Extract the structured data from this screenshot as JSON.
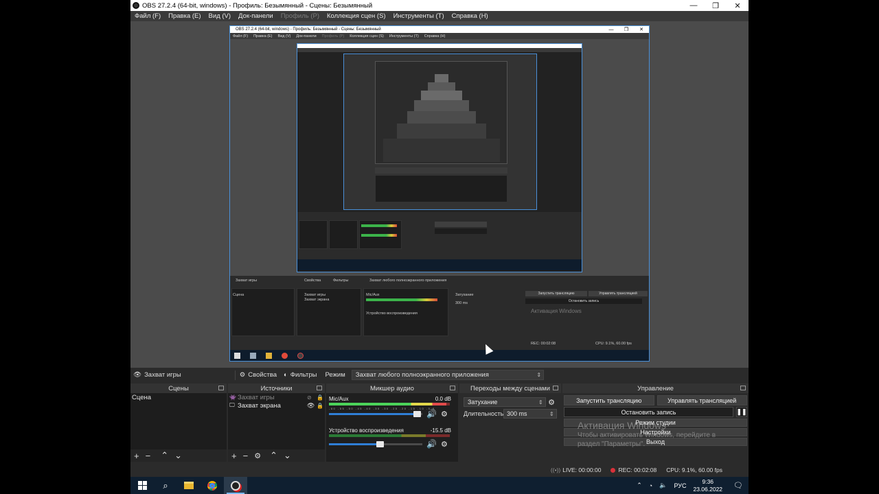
{
  "window": {
    "title": "OBS 27.2.4 (64-bit, windows) - Профиль: Безымянный - Сцены: Безымянный",
    "minimize": "—",
    "restore": "❐",
    "close": "✕"
  },
  "menu": [
    {
      "label": "Файл (F)",
      "disabled": false
    },
    {
      "label": "Правка (E)",
      "disabled": false
    },
    {
      "label": "Вид (V)",
      "disabled": false
    },
    {
      "label": "Док-панели",
      "disabled": false
    },
    {
      "label": "Профиль (P)",
      "disabled": true
    },
    {
      "label": "Коллекция сцен (S)",
      "disabled": false
    },
    {
      "label": "Инструменты (T)",
      "disabled": false
    },
    {
      "label": "Справка (H)",
      "disabled": false
    }
  ],
  "source_toolbar": {
    "current_source": "Захват игры",
    "properties": "Свойства",
    "filters": "Фильтры",
    "mode_label": "Режим",
    "mode_value": "Захват любого полноэкранного приложения"
  },
  "docks": {
    "scenes": {
      "title": "Сцены",
      "items": [
        "Сцена"
      ]
    },
    "sources": {
      "title": "Источники",
      "items": [
        {
          "name": "Захват игры",
          "visible": false,
          "dimmed": true
        },
        {
          "name": "Захват экрана",
          "visible": true,
          "dimmed": false
        }
      ]
    },
    "mixer": {
      "title": "Микшер аудио",
      "channels": [
        {
          "name": "Mic/Aux",
          "db": "0.0 dB",
          "level": 0.97,
          "volume": 0.95
        },
        {
          "name": "Устройство воспроизведения",
          "db": "-15.5 dB",
          "level": 0.0,
          "volume": 0.55
        }
      ],
      "scale": "-60 -55 -50 -45 -40 -35 -30 -25 -20 -15 -10 -5 0"
    },
    "transitions": {
      "title": "Переходы между сценами",
      "transition": "Затухание",
      "duration_label": "Длительность",
      "duration_value": "300 ms"
    },
    "controls": {
      "title": "Управление",
      "start_stream": "Запустить трансляцию",
      "manage_stream": "Управлять трансляцией",
      "stop_recording": "Остановить запись",
      "studio_mode": "Режим студии",
      "settings": "Настройки",
      "exit": "Выход"
    }
  },
  "activation": {
    "title": "Активация Windows",
    "line1": "Чтобы активировать Windows, перейдите в",
    "line2": "раздел \"Параметры\"."
  },
  "status": {
    "live": "LIVE: 00:00:00",
    "rec": "REC: 00:02:08",
    "cpu": "CPU: 9.1%, 60.00 fps"
  },
  "taskbar": {
    "tray_lang": "РУС",
    "time": "9:36",
    "date": "23.06.2022"
  },
  "colors": {
    "background": "#2b2b2b",
    "preview_bg": "#4b4b4b",
    "selection_border": "#4a90d9",
    "rec_red": "#d9313a",
    "volume_blue": "#2f7fd6"
  }
}
